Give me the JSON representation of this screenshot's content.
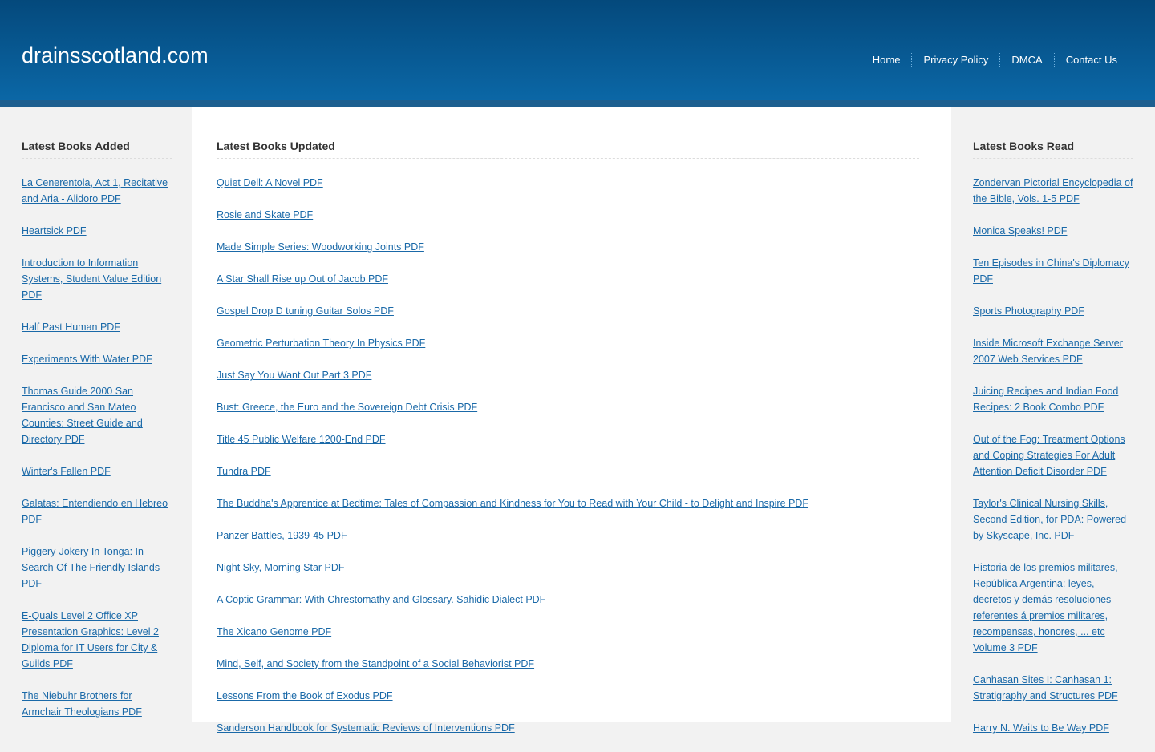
{
  "site": {
    "title": "drainsscotland.com"
  },
  "nav": {
    "items": [
      "Home",
      "Privacy Policy",
      "DMCA",
      "Contact Us"
    ]
  },
  "left": {
    "heading": "Latest Books Added",
    "items": [
      "La Cenerentola, Act 1, Recitative and Aria - Alidoro PDF",
      "Heartsick PDF",
      "Introduction to Information Systems, Student Value Edition PDF",
      "Half Past Human PDF",
      "Experiments With Water PDF",
      "Thomas Guide 2000 San Francisco and San Mateo Counties: Street Guide and Directory PDF",
      "Winter's Fallen PDF",
      "Galatas: Entendiendo en Hebreo PDF",
      "Piggery-Jokery In Tonga: In Search Of The Friendly Islands PDF",
      "E-Quals Level 2 Office XP Presentation Graphics: Level 2 Diploma for IT Users for City & Guilds PDF",
      "The Niebuhr Brothers for Armchair Theologians PDF"
    ]
  },
  "middle": {
    "heading": "Latest Books Updated",
    "items": [
      "Quiet Dell: A Novel PDF",
      "Rosie and Skate PDF",
      "Made Simple Series: Woodworking Joints PDF",
      "A Star Shall Rise up Out of Jacob PDF",
      "Gospel Drop D tuning Guitar Solos PDF",
      "Geometric Perturbation Theory In Physics PDF",
      "Just Say You Want Out Part 3 PDF",
      "Bust: Greece, the Euro and the Sovereign Debt Crisis PDF",
      "Title 45 Public Welfare 1200-End PDF",
      "Tundra PDF",
      "The Buddha's Apprentice at Bedtime: Tales of Compassion and Kindness for You to Read with Your Child - to Delight and Inspire PDF",
      "Panzer Battles, 1939-45 PDF",
      "Night Sky, Morning Star PDF",
      "A Coptic Grammar: With Chrestomathy and Glossary. Sahidic Dialect PDF",
      "The Xicano Genome PDF",
      "Mind, Self, and Society from the Standpoint of a Social Behaviorist PDF",
      "Lessons From the Book of Exodus PDF",
      "Sanderson Handbook for Systematic Reviews of Interventions PDF"
    ]
  },
  "right": {
    "heading": "Latest Books Read",
    "items": [
      "Zondervan Pictorial Encyclopedia of the Bible, Vols. 1-5 PDF",
      "Monica Speaks! PDF",
      "Ten Episodes in China's Diplomacy PDF",
      "Sports Photography PDF",
      "Inside Microsoft Exchange Server 2007 Web Services PDF",
      "Juicing Recipes and Indian Food Recipes: 2 Book Combo PDF",
      "Out of the Fog: Treatment Options and Coping Strategies For Adult Attention Deficit Disorder PDF",
      "Taylor's Clinical Nursing Skills, Second Edition, for PDA: Powered by Skyscape, Inc. PDF",
      "Historia de los premios militares, República Argentina: leyes, decretos y demás resoluciones referentes á premios militares, recompensas, honores, ... etc Volume 3 PDF",
      "Canhasan Sites I: Canhasan 1: Stratigraphy and Structures PDF",
      "Harry N. Waits to Be Way PDF"
    ]
  }
}
